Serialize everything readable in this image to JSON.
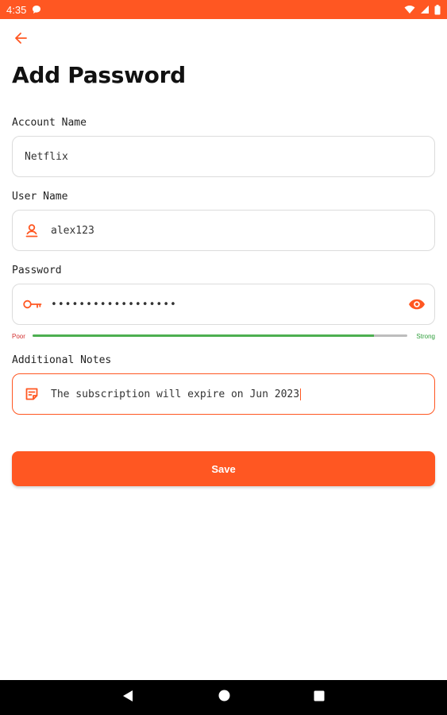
{
  "status_bar": {
    "time": "4:35",
    "icons": [
      "chat-bubble-icon",
      "wifi-icon",
      "cellular-signal-icon",
      "battery-icon"
    ]
  },
  "header": {
    "back_icon": "arrow-back-icon",
    "title": "Add Password"
  },
  "form": {
    "account_name": {
      "label": "Account Name",
      "value": "Netflix"
    },
    "user_name": {
      "label": "User Name",
      "value": "alex123",
      "icon": "person-icon"
    },
    "password": {
      "label": "Password",
      "value": "••••••••••••••••••",
      "icon": "key-icon",
      "toggle_icon": "eye-icon",
      "strength": {
        "poor_label": "Poor",
        "strong_label": "Strong",
        "level": 0.91
      }
    },
    "notes": {
      "label": "Additional Notes",
      "value": "The subscription will expire on Jun 2023",
      "icon": "note-icon"
    }
  },
  "actions": {
    "save_label": "Save"
  },
  "nav_bar": {
    "icons": [
      "back-triangle-icon",
      "home-circle-icon",
      "recents-square-icon"
    ]
  },
  "colors": {
    "accent": "#ff5722",
    "strength_good": "#4caf50",
    "strength_poor": "#d32f2f",
    "strength_strong": "#2e9e3a"
  }
}
